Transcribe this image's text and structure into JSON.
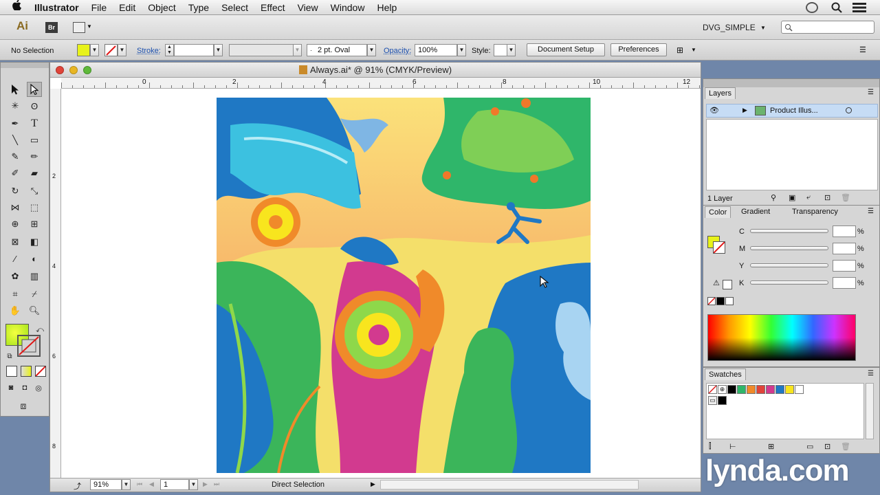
{
  "menubar": {
    "apple": "",
    "items": [
      "Illustrator",
      "File",
      "Edit",
      "Object",
      "Type",
      "Select",
      "Effect",
      "View",
      "Window",
      "Help"
    ]
  },
  "appbar": {
    "ai_logo": "Ai",
    "br_logo": "Br",
    "workspace": "DVG_SIMPLE"
  },
  "control": {
    "selection": "No Selection",
    "stroke_label": "Stroke:",
    "brush": "2 pt. Oval",
    "opacity_label": "Opacity:",
    "opacity_value": "100%",
    "style_label": "Style:",
    "document_setup": "Document Setup",
    "preferences": "Preferences"
  },
  "document": {
    "title": "Always.ai* @ 91% (CMYK/Preview)",
    "ruler_h": [
      "0",
      "2",
      "4",
      "6",
      "8",
      "10",
      "12"
    ],
    "ruler_v": [
      "2",
      "4",
      "6",
      "8"
    ],
    "zoom": "91%",
    "artboard": "1",
    "status": "Direct Selection"
  },
  "layers": {
    "tab": "Layers",
    "layer_name": "Product Illus...",
    "count": "1 Layer"
  },
  "color": {
    "tabs": [
      "Color",
      "Gradient",
      "Transparency"
    ],
    "channels": [
      "C",
      "M",
      "Y",
      "K"
    ],
    "pct": "%"
  },
  "swatches": {
    "tab": "Swatches"
  },
  "watermark": "lynda.com",
  "colors": {
    "fill": "#e8f21a",
    "accent_blue": "#1c6fb7",
    "magenta": "#d23a8f",
    "orange": "#f08a2a"
  }
}
